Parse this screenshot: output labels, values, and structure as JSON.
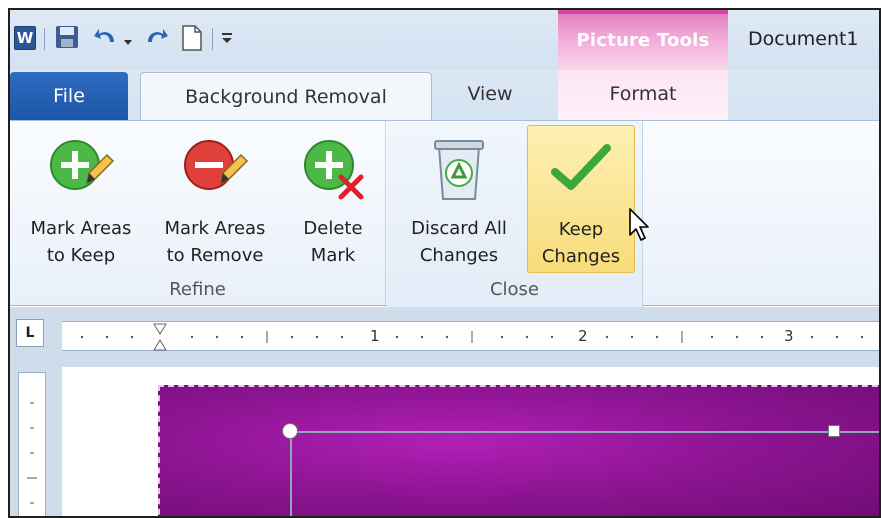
{
  "qat": {
    "word_letter": "W",
    "icons": [
      "word-app-icon",
      "save-icon",
      "undo-icon",
      "undo-dropdown-icon",
      "redo-icon",
      "new-document-icon",
      "customize-qat-icon"
    ]
  },
  "contextual": {
    "label": "Picture Tools",
    "color": "#d6449c"
  },
  "window": {
    "title": "Document1"
  },
  "tabs": {
    "file": "File",
    "background_removal": "Background Removal",
    "view": "View",
    "format": "Format"
  },
  "ribbon": {
    "groups": {
      "refine": {
        "label": "Refine",
        "buttons": [
          {
            "line1": "Mark Areas",
            "line2": "to Keep",
            "icon": "mark-keep-icon"
          },
          {
            "line1": "Mark Areas",
            "line2": "to Remove",
            "icon": "mark-remove-icon"
          },
          {
            "line1": "Delete",
            "line2": "Mark",
            "icon": "delete-mark-icon"
          }
        ]
      },
      "close": {
        "label": "Close",
        "buttons": [
          {
            "line1": "Discard All",
            "line2": "Changes",
            "icon": "recycle-bin-icon"
          },
          {
            "line1": "Keep",
            "line2": "Changes",
            "icon": "checkmark-icon"
          }
        ]
      }
    }
  },
  "ruler": {
    "corner": "L",
    "numbers": [
      "1",
      "2",
      "3"
    ]
  },
  "colors": {
    "accent": "#2b5797",
    "picture_tools": "#d6449c",
    "image": "#8e1593",
    "highlight": "#f8dc79"
  }
}
